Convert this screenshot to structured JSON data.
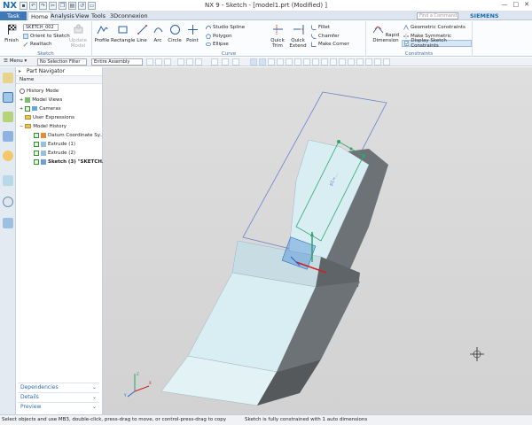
{
  "app": {
    "logo": "NX",
    "title": "NX 9 - Sketch - [model1.prt (Modified) ]",
    "siemens": "SIEMENS"
  },
  "tabs": {
    "task": "Task",
    "home": "Home",
    "analysis": "Analysis",
    "view": "View",
    "tools": "Tools",
    "connexion": "3Dconnexion",
    "find_placeholder": "Find a Command"
  },
  "ribbon": {
    "sketch_group": {
      "finish": "Finish",
      "sketch_name": "SKETCH_002",
      "orient": "Orient to Sketch",
      "reattach": "Reattach",
      "update_model": "Update Model",
      "label": "Sketch"
    },
    "curve_group": {
      "profile": "Profile",
      "rectangle": "Rectangle",
      "line": "Line",
      "arc": "Arc",
      "circle": "Circle",
      "point": "Point",
      "studio_spline": "Studio Spline",
      "polygon": "Polygon",
      "ellipse": "Ellipse",
      "quick_trim": "Quick Trim",
      "quick_extend": "Quick Extend",
      "fillet": "Fillet",
      "chamfer": "Chamfer",
      "make_corner": "Make Corner",
      "label": "Curve"
    },
    "constraints_group": {
      "rapid_dimension": "Rapid Dimension",
      "geometric": "Geometric Constraints",
      "symmetric": "Make Symmetric",
      "display": "Display Sketch Constraints",
      "label": "Constraints"
    }
  },
  "toolbar": {
    "menu": "Menu",
    "selection_filter": "No Selection Filter",
    "assembly": "Entire Assembly"
  },
  "navigator": {
    "title": "Part Navigator",
    "column": "Name",
    "items": [
      {
        "label": "History Mode"
      },
      {
        "label": "Model Views"
      },
      {
        "label": "Cameras"
      },
      {
        "label": "User Expressions"
      },
      {
        "label": "Model History"
      },
      {
        "label": "Datum Coordinate Sy..."
      },
      {
        "label": "Extrude (1)"
      },
      {
        "label": "Extrude (2)"
      },
      {
        "label": "Sketch (3) \"SKETCH..."
      }
    ],
    "sections": {
      "dependencies": "Dependencies",
      "details": "Details",
      "preview": "Preview"
    }
  },
  "status": {
    "left": "Select objects and use MB3, double-click, press-drag to move, or control-press-drag to copy",
    "right": "Sketch is fully constrained with 1 auto dimensions"
  },
  "colors": {
    "accent": "#3f79b7",
    "brand": "#1b6ab5",
    "viewport_bg": "#d6d6d6",
    "part_face": "#d9eef3",
    "part_shadow": "#6d7276"
  }
}
